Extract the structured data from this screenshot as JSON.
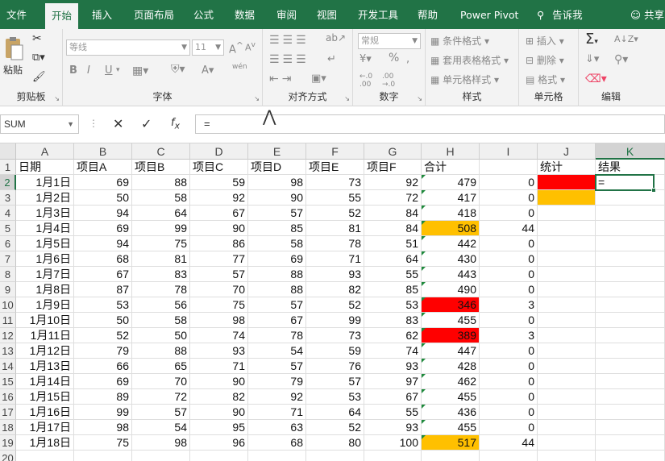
{
  "menu": {
    "tabs": [
      "文件",
      "开始",
      "插入",
      "页面布局",
      "公式",
      "数据",
      "审阅",
      "视图",
      "开发工具",
      "帮助",
      "Power Pivot"
    ],
    "active_tab": "开始",
    "tell_me": "告诉我",
    "share": "共享"
  },
  "ribbon": {
    "clipboard": {
      "paste": "粘贴",
      "label": "剪贴板"
    },
    "font": {
      "font_name": "等线",
      "font_size": "11",
      "bold": "B",
      "italic": "I",
      "underline": "U",
      "phonetic": "wén",
      "label": "字体"
    },
    "alignment": {
      "label": "对齐方式"
    },
    "number": {
      "format": "常规",
      "percent": "%",
      "label": "数字"
    },
    "styles": {
      "conditional": "条件格式",
      "table": "套用表格格式",
      "cell": "单元格样式",
      "label": "样式"
    },
    "cells": {
      "insert": "插入",
      "delete": "删除",
      "format": "格式",
      "label": "单元格"
    },
    "editing": {
      "label": "编辑"
    }
  },
  "formula_bar": {
    "name_box": "SUM",
    "formula": "="
  },
  "grid": {
    "columns": [
      "A",
      "B",
      "C",
      "D",
      "E",
      "F",
      "G",
      "H",
      "I",
      "J",
      "K"
    ],
    "selected_column": "K",
    "selected_row": 2,
    "header_row": [
      "日期",
      "项目A",
      "项目B",
      "项目C",
      "项目D",
      "项目E",
      "项目F",
      "合计",
      "",
      "统计",
      "结果"
    ],
    "rows": [
      [
        "1月1日",
        69,
        88,
        59,
        98,
        73,
        92,
        479,
        0
      ],
      [
        "1月2日",
        50,
        58,
        92,
        90,
        55,
        72,
        417,
        0
      ],
      [
        "1月3日",
        94,
        64,
        67,
        57,
        52,
        84,
        418,
        0
      ],
      [
        "1月4日",
        69,
        99,
        90,
        85,
        81,
        84,
        508,
        44
      ],
      [
        "1月5日",
        94,
        75,
        86,
        58,
        78,
        51,
        442,
        0
      ],
      [
        "1月6日",
        68,
        81,
        77,
        69,
        71,
        64,
        430,
        0
      ],
      [
        "1月7日",
        67,
        83,
        57,
        88,
        93,
        55,
        443,
        0
      ],
      [
        "1月8日",
        87,
        78,
        70,
        88,
        82,
        85,
        490,
        0
      ],
      [
        "1月9日",
        53,
        56,
        75,
        57,
        52,
        53,
        346,
        3
      ],
      [
        "1月10日",
        50,
        58,
        98,
        67,
        99,
        83,
        455,
        0
      ],
      [
        "1月11日",
        52,
        50,
        74,
        78,
        73,
        62,
        389,
        3
      ],
      [
        "1月12日",
        79,
        88,
        93,
        54,
        59,
        74,
        447,
        0
      ],
      [
        "1月13日",
        66,
        65,
        71,
        57,
        76,
        93,
        428,
        0
      ],
      [
        "1月14日",
        69,
        70,
        90,
        79,
        57,
        97,
        462,
        0
      ],
      [
        "1月15日",
        89,
        72,
        82,
        92,
        53,
        67,
        455,
        0
      ],
      [
        "1月16日",
        99,
        57,
        90,
        71,
        64,
        55,
        436,
        0
      ],
      [
        "1月17日",
        98,
        54,
        95,
        63,
        52,
        93,
        455,
        0
      ],
      [
        "1月18日",
        75,
        98,
        96,
        68,
        80,
        100,
        517,
        44
      ]
    ],
    "highlight_colors": {
      "red": "#ff0000",
      "orange": "#ffc000"
    },
    "h_fill": [
      "",
      "",
      "",
      "orange",
      "",
      "",
      "",
      "",
      "red",
      "",
      "red",
      "",
      "",
      "",
      "",
      "",
      "",
      "orange"
    ],
    "j_fill": [
      "red",
      "orange"
    ],
    "k2_value": "="
  }
}
